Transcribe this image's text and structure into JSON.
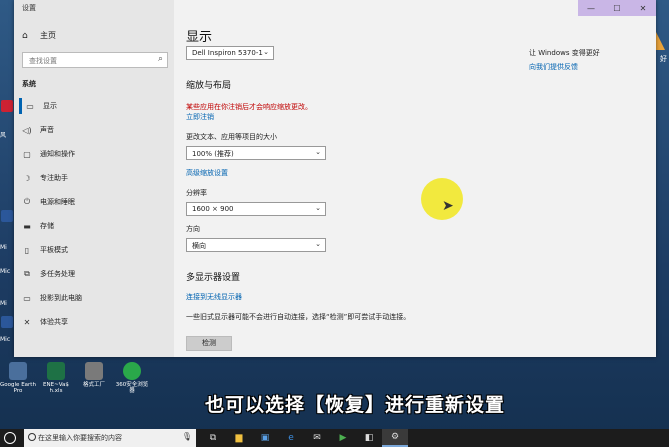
{
  "window": {
    "title": "设置",
    "caption": {
      "minimize": "—",
      "maximize": "☐",
      "close": "✕"
    }
  },
  "nav": {
    "home": "主页",
    "search_placeholder": "查找设置",
    "section": "系统",
    "items": [
      {
        "icon": "monitor-icon",
        "glyph": "▭",
        "label": "显示",
        "active": true
      },
      {
        "icon": "speaker-icon",
        "glyph": "◁)",
        "label": "声音"
      },
      {
        "icon": "notification-icon",
        "glyph": "▢",
        "label": "通知和操作"
      },
      {
        "icon": "moon-icon",
        "glyph": "☽",
        "label": "专注助手"
      },
      {
        "icon": "power-icon",
        "glyph": "⏻",
        "label": "电源和睡眠"
      },
      {
        "icon": "storage-icon",
        "glyph": "▬",
        "label": "存储"
      },
      {
        "icon": "tablet-icon",
        "glyph": "▯",
        "label": "平板模式"
      },
      {
        "icon": "multitask-icon",
        "glyph": "⧉",
        "label": "多任务处理"
      },
      {
        "icon": "project-icon",
        "glyph": "▭",
        "label": "投影到此电脑"
      },
      {
        "icon": "share-icon",
        "glyph": "✕",
        "label": "体验共享"
      }
    ]
  },
  "content": {
    "title": "显示",
    "monitor_select": "Dell Inspiron 5370-1",
    "scale_heading": "缩放与布局",
    "warning": "某些应用在你注销后才会响应缩放更改。",
    "signout_link": "立即注销",
    "text_size_label": "更改文本、应用等项目的大小",
    "text_size_value": "100% (推荐)",
    "advanced_scaling_link": "高级缩放设置",
    "resolution_label": "分辨率",
    "resolution_value": "1600 × 900",
    "orientation_label": "方向",
    "orientation_value": "横向",
    "multi_display_heading": "多显示器设置",
    "wireless_link": "连接到无线显示器",
    "detect_note": "一些旧式显示器可能不会进行自动连接，选择“检测”即可尝试手动连接。",
    "detect_button": "检测"
  },
  "info": {
    "question": "让 Windows 变得更好",
    "feedback_link": "向我们提供反馈"
  },
  "desktop_icons": [
    {
      "label": "Google Earth Pro",
      "color": "#4a6f9c"
    },
    {
      "label": "ENE~Va$ h.xls",
      "color": "#1e7145"
    },
    {
      "label": "格式工厂",
      "color": "#7a7a7a"
    },
    {
      "label": "360安全浏览器",
      "color": "#2aa84a"
    }
  ],
  "left_strip_labels": [
    "风",
    "Mi",
    "Mic",
    "Mi",
    "Mic"
  ],
  "right_strip_label": "好",
  "subtitle": "也可以选择【恢复】进行重新设置",
  "taskbar": {
    "search_placeholder": "在这里输入你要搜索的内容",
    "mic": "🎙",
    "icons": [
      {
        "name": "task-view-icon",
        "glyph": "⧉"
      },
      {
        "name": "file-explorer-icon",
        "glyph": "▆"
      },
      {
        "name": "store-icon",
        "glyph": "▣"
      },
      {
        "name": "edge-icon",
        "glyph": "e"
      },
      {
        "name": "mail-icon",
        "glyph": "✉"
      },
      {
        "name": "play-icon",
        "glyph": "▶"
      },
      {
        "name": "app-icon",
        "glyph": "◧"
      },
      {
        "name": "settings-icon",
        "glyph": "⚙"
      }
    ]
  }
}
